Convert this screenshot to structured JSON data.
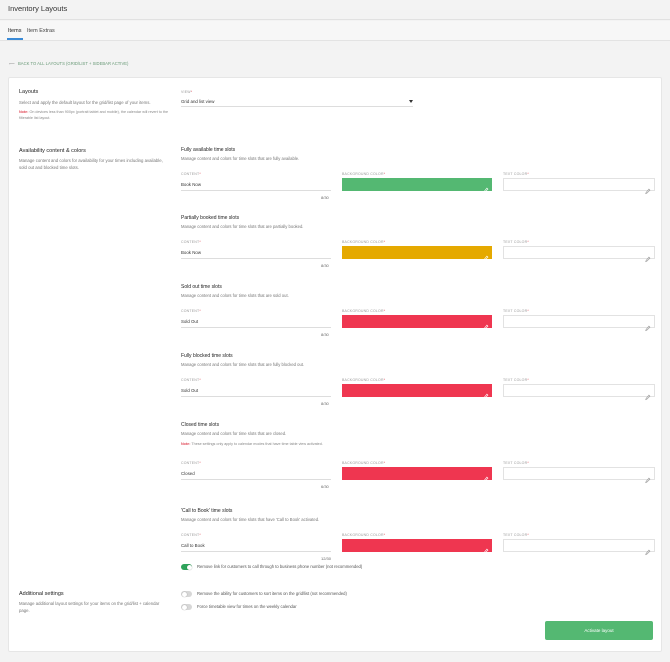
{
  "app": {
    "title": "Inventory Layouts"
  },
  "tabs": [
    {
      "label": "Items"
    },
    {
      "label": "Item Extras"
    }
  ],
  "back_link": {
    "label": "BACK TO ALL LAYOUTS (GRID/LIST + SIDEBAR ACTIVE)"
  },
  "colors": {
    "green": "#54b872",
    "yellow": "#e5a900",
    "red": "#ef3650",
    "accent_blue": "#3a8ad6",
    "toggle_on": "#2fa45b"
  },
  "layouts": {
    "title": "Layouts",
    "description": "Select and apply the default layout for the grid/list page of your items.",
    "note_label": "Note:",
    "note_text": "On devices less than 900px (portrait tablet and mobile), the calendar will revert to the filterable list layout.",
    "view_label": "VIEW",
    "view_value": "Grid and list view"
  },
  "availability": {
    "title": "Availability content & colors",
    "description": "Manage content and colors for availability for your times including available, sold out and blocked time slots.",
    "content_label": "CONTENT",
    "bg_label": "BACKGROUND COLOR",
    "text_label": "TEXT COLOR",
    "groups": [
      {
        "title": "Fully available time slots",
        "desc": "Manage content and colors for time slots that are fully available.",
        "content": "Book Now",
        "counter": "8/30",
        "color": "#54b872"
      },
      {
        "title": "Partially booked time slots",
        "desc": "Manage content and colors for time slots that are partially booked.",
        "content": "Book Now",
        "counter": "8/30",
        "color": "#e5a900"
      },
      {
        "title": "Sold out time slots",
        "desc": "Manage content and colors for time slots that are sold out.",
        "content": "Sold Out",
        "counter": "8/30",
        "color": "#ef3650"
      },
      {
        "title": "Fully blocked time slots",
        "desc": "Manage content and colors for time slots that are fully blocked out.",
        "content": "Sold Out",
        "counter": "8/30",
        "color": "#ef3650"
      },
      {
        "title": "Closed time slots",
        "desc": "Manage content and colors for time slots that are closed.",
        "note_label": "Note:",
        "note_text": "These settings only apply to calendar modes that have time table view activated.",
        "content": "Closed",
        "counter": "6/30",
        "color": "#ef3650"
      },
      {
        "title": "'Call to Book' time slots",
        "desc": "Manage content and colors for time slots that have 'Call to Book' activated.",
        "content": "Call to Book",
        "counter": "12/30",
        "color": "#ef3650"
      }
    ],
    "remove_link_toggle": {
      "label": "Remove link for customers to call through to business phone number (not recommended)",
      "on": true
    }
  },
  "additional": {
    "title": "Additional settings",
    "description": "Manage additional layout settings for your items on the grid/list + calendar page.",
    "toggles": [
      {
        "label": "Remove the ability for customers to sort items on the grid/list (not recommended)",
        "on": false
      },
      {
        "label": "Force timetable view for times on the weekly calendar",
        "on": false
      }
    ]
  },
  "activate_button": {
    "label": "Activate layout",
    "color": "#54b872"
  }
}
